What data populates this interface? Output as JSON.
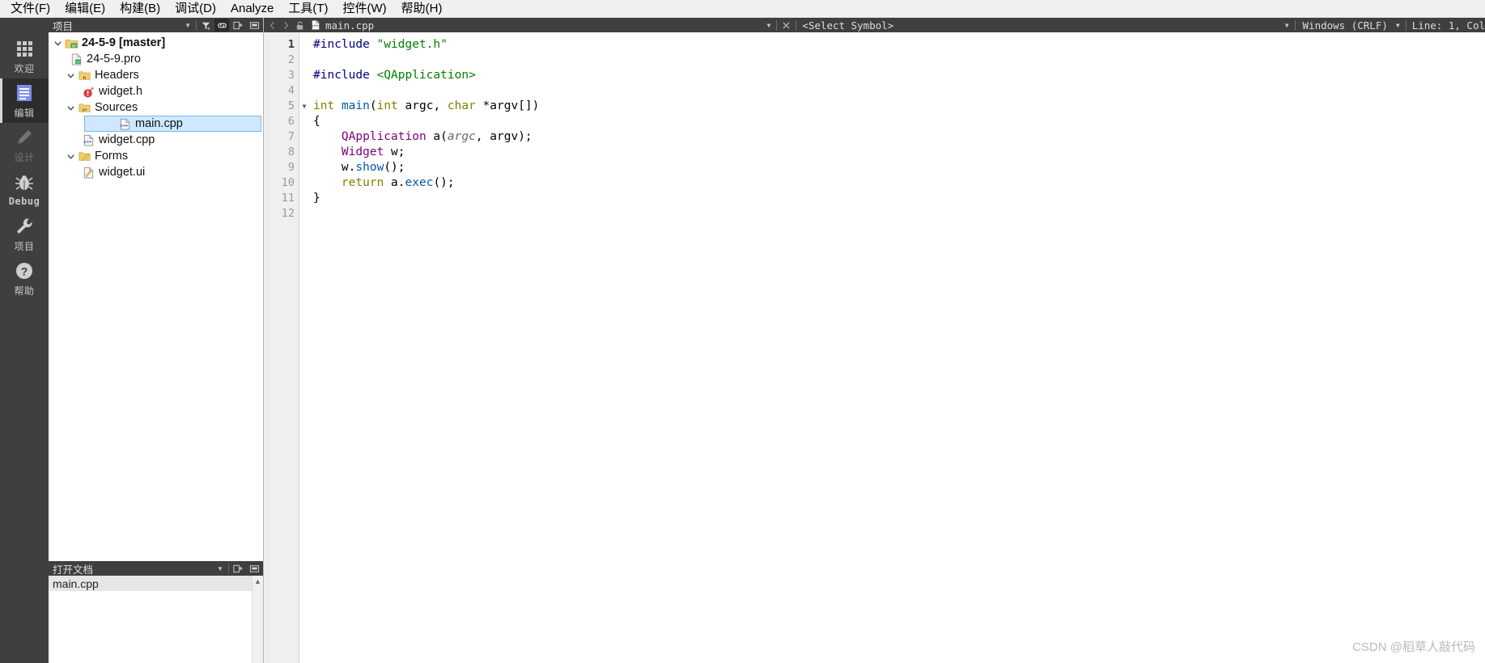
{
  "menubar": {
    "items": [
      {
        "label": "文件(F)",
        "mnemonic": "F"
      },
      {
        "label": "编辑(E)",
        "mnemonic": "E"
      },
      {
        "label": "构建(B)",
        "mnemonic": "B"
      },
      {
        "label": "调试(D)",
        "mnemonic": "D"
      },
      {
        "label": "Analyze",
        "mnemonic": "A"
      },
      {
        "label": "工具(T)",
        "mnemonic": "T"
      },
      {
        "label": "控件(W)",
        "mnemonic": "W"
      },
      {
        "label": "帮助(H)",
        "mnemonic": "H"
      }
    ]
  },
  "modebar": {
    "modes": [
      {
        "label": "欢迎",
        "icon": "grid-icon",
        "state": "normal"
      },
      {
        "label": "编辑",
        "icon": "document-icon",
        "state": "active"
      },
      {
        "label": "设计",
        "icon": "pencil-icon",
        "state": "disabled"
      },
      {
        "label": "Debug",
        "icon": "bug-icon",
        "state": "normal"
      },
      {
        "label": "项目",
        "icon": "wrench-icon",
        "state": "normal"
      },
      {
        "label": "帮助",
        "icon": "question-icon",
        "state": "normal"
      }
    ]
  },
  "project_dock": {
    "title": "项目",
    "buttons": [
      "filter-icon",
      "link-icon",
      "split-icon",
      "minimize-icon"
    ],
    "tree": [
      {
        "label": "24-5-9 [master]",
        "icon": "qt-project-icon",
        "indent": 0,
        "expander": "expanded",
        "bold": true,
        "selected": false
      },
      {
        "label": "24-5-9.pro",
        "icon": "pro-file-icon",
        "indent": 1,
        "expander": "none",
        "bold": false,
        "selected": false
      },
      {
        "label": "Headers",
        "icon": "folder-h-icon",
        "indent": 1,
        "expander": "expanded",
        "bold": false,
        "selected": false
      },
      {
        "label": "widget.h",
        "icon": "header-file-icon",
        "indent": 2,
        "expander": "none",
        "bold": false,
        "selected": false
      },
      {
        "label": "Sources",
        "icon": "folder-cpp-icon",
        "indent": 1,
        "expander": "expanded",
        "bold": false,
        "selected": false
      },
      {
        "label": "main.cpp",
        "icon": "cpp-file-icon",
        "indent": 2,
        "expander": "none",
        "bold": false,
        "selected": true
      },
      {
        "label": "widget.cpp",
        "icon": "cpp-file-icon",
        "indent": 2,
        "expander": "none",
        "bold": false,
        "selected": false
      },
      {
        "label": "Forms",
        "icon": "folder-ui-icon",
        "indent": 1,
        "expander": "expanded",
        "bold": false,
        "selected": false
      },
      {
        "label": "widget.ui",
        "icon": "ui-file-icon",
        "indent": 2,
        "expander": "none",
        "bold": false,
        "selected": false
      }
    ]
  },
  "open_documents": {
    "title": "打开文档",
    "buttons": [
      "split-icon",
      "minimize-icon"
    ],
    "items": [
      {
        "label": "main.cpp",
        "selected": true
      }
    ]
  },
  "editor_toolbar": {
    "back_icon": "chevron-left-icon",
    "forward_icon": "chevron-right-icon",
    "lock_icon": "unlocked-icon",
    "file_icon": "cpp-file-icon",
    "file_name": "main.cpp",
    "close_icon": "close-icon",
    "symbol_placeholder": "<Select Symbol>",
    "line_ending": "Windows (CRLF)",
    "cursor_position": "Line: 1, Col"
  },
  "code": {
    "lines": [
      {
        "n": 1,
        "fold": false,
        "tokens": [
          {
            "t": "#include",
            "c": "pre"
          },
          {
            "t": " ",
            "c": "plain"
          },
          {
            "t": "\"widget.h\"",
            "c": "str"
          }
        ]
      },
      {
        "n": 2,
        "fold": false,
        "tokens": []
      },
      {
        "n": 3,
        "fold": false,
        "tokens": [
          {
            "t": "#include",
            "c": "pre"
          },
          {
            "t": " ",
            "c": "plain"
          },
          {
            "t": "<QApplication>",
            "c": "str"
          }
        ]
      },
      {
        "n": 4,
        "fold": false,
        "tokens": []
      },
      {
        "n": 5,
        "fold": true,
        "tokens": [
          {
            "t": "int",
            "c": "key"
          },
          {
            "t": " ",
            "c": "plain"
          },
          {
            "t": "main",
            "c": "fn"
          },
          {
            "t": "(",
            "c": "plain"
          },
          {
            "t": "int",
            "c": "key"
          },
          {
            "t": " argc, ",
            "c": "plain"
          },
          {
            "t": "char",
            "c": "key"
          },
          {
            "t": " *argv[])",
            "c": "plain"
          }
        ]
      },
      {
        "n": 6,
        "fold": false,
        "tokens": [
          {
            "t": "{",
            "c": "plain"
          }
        ]
      },
      {
        "n": 7,
        "fold": false,
        "tokens": [
          {
            "t": "    ",
            "c": "plain"
          },
          {
            "t": "QApplication",
            "c": "type"
          },
          {
            "t": " a(",
            "c": "plain"
          },
          {
            "t": "argc",
            "c": "param"
          },
          {
            "t": ", argv);",
            "c": "plain"
          }
        ]
      },
      {
        "n": 8,
        "fold": false,
        "tokens": [
          {
            "t": "    ",
            "c": "plain"
          },
          {
            "t": "Widget",
            "c": "type"
          },
          {
            "t": " w;",
            "c": "plain"
          }
        ]
      },
      {
        "n": 9,
        "fold": false,
        "tokens": [
          {
            "t": "    w.",
            "c": "plain"
          },
          {
            "t": "show",
            "c": "fn"
          },
          {
            "t": "();",
            "c": "plain"
          }
        ]
      },
      {
        "n": 10,
        "fold": false,
        "tokens": [
          {
            "t": "    ",
            "c": "plain"
          },
          {
            "t": "return",
            "c": "key"
          },
          {
            "t": " a.",
            "c": "plain"
          },
          {
            "t": "exec",
            "c": "fn"
          },
          {
            "t": "();",
            "c": "plain"
          }
        ]
      },
      {
        "n": 11,
        "fold": false,
        "tokens": [
          {
            "t": "}",
            "c": "plain"
          }
        ]
      },
      {
        "n": 12,
        "fold": false,
        "tokens": []
      }
    ],
    "current_line": 1
  },
  "watermark": {
    "text": "CSDN @稻草人敲代码"
  },
  "colors": {
    "dark_chrome": "#3f3f3f",
    "mode_active_bg": "#2d2d2d",
    "selection_blue": "#cde8ff",
    "accent_blue": "#4a6fe8"
  }
}
